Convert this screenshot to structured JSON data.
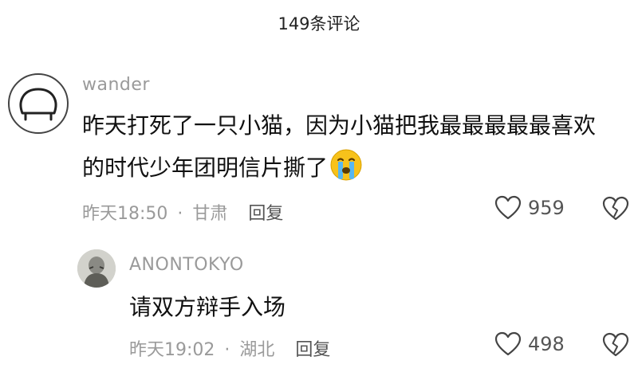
{
  "header": {
    "title": "149条评论"
  },
  "comments": [
    {
      "username": "wander",
      "text_line1": "昨天打死了一只小猫，因为小猫把我最最最最最喜欢",
      "text_line2": "的时代少年团明信片撕了",
      "emoji_icon": "crying-face-icon",
      "time": "昨天18:50",
      "separator": "·",
      "location": "甘肃",
      "reply_label": "回复",
      "likes": "959"
    },
    {
      "username": "ANONTOKYO",
      "text": "请双方辩手入场",
      "time": "昨天19:02",
      "separator": "·",
      "location": "湖北",
      "reply_label": "回复",
      "likes": "498"
    }
  ],
  "colors": {
    "meta_gray": "#9a9a9a",
    "text_black": "#111111",
    "emoji_yellow": "#f7c21b",
    "emoji_tear": "#58b7f0"
  }
}
